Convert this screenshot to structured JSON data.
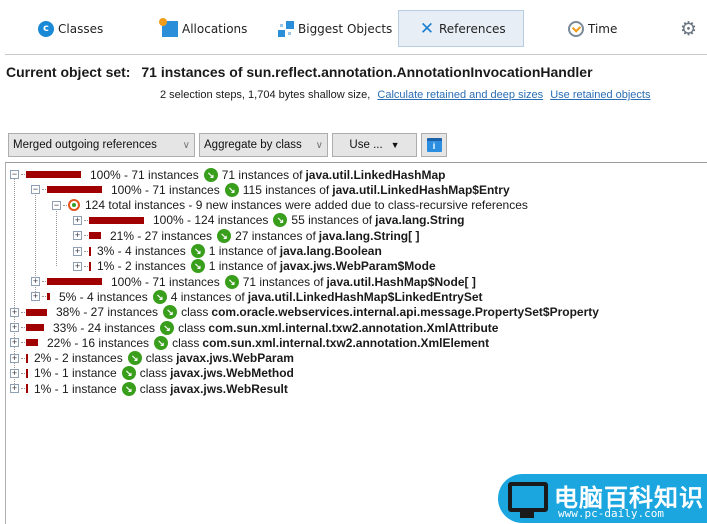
{
  "toolbar": {
    "tabs": [
      {
        "label": "Classes",
        "icon": "classes-icon",
        "active": false
      },
      {
        "label": "Allocations",
        "icon": "allocations-icon",
        "active": false
      },
      {
        "label": "Biggest Objects",
        "icon": "biggest-objects-icon",
        "active": false
      },
      {
        "label": "References",
        "icon": "references-icon",
        "active": true
      },
      {
        "label": "Time",
        "icon": "time-icon",
        "active": false
      },
      {
        "label": "",
        "icon": "gear-icon",
        "active": false
      }
    ]
  },
  "header": {
    "label": "Current object set:",
    "value": "71 instances of sun.reflect.annotation.AnnotationInvocationHandler",
    "info": "2 selection steps, 1,704 bytes shallow size,",
    "link_calculate": "Calculate retained and deep sizes",
    "link_use_retained": "Use retained objects"
  },
  "controls": {
    "view_mode": "Merged outgoing references",
    "aggregation": "Aggregate by class",
    "use_button": "Use ...",
    "use_arrow": "▼",
    "chevron": "∨",
    "info_button_icon": "i"
  },
  "tree": {
    "rows": [
      {
        "level": 0,
        "expander": "−",
        "percent": 100,
        "pct_text": "100% - 71 instances",
        "prefix": "71 instances of",
        "cls": "java.util.LinkedHashMap"
      },
      {
        "level": 1,
        "expander": "−",
        "percent": 100,
        "pct_text": "100% - 71 instances",
        "prefix": "115 instances of",
        "cls": "java.util.LinkedHashMap$Entry"
      },
      {
        "level": 2,
        "expander": "−",
        "recursive": true,
        "text": "124 total instances - 9 new instances were added due to class-recursive references"
      },
      {
        "level": 3,
        "expander": "+",
        "percent": 100,
        "pct_text": "100% - 124 instances",
        "prefix": "55 instances of",
        "cls": "java.lang.String"
      },
      {
        "level": 3,
        "expander": "+",
        "percent": 21,
        "pct_text": "21% - 27 instances",
        "prefix": "27 instances of",
        "cls": "java.lang.String[ ]"
      },
      {
        "level": 3,
        "expander": "+",
        "percent": 3,
        "pct_text": "3% - 4 instances",
        "prefix": "1 instance of",
        "cls": "java.lang.Boolean"
      },
      {
        "level": 3,
        "expander": "+",
        "percent": 1,
        "pct_text": "1% - 2 instances",
        "prefix": "1 instance of",
        "cls": "javax.jws.WebParam$Mode"
      },
      {
        "level": 1,
        "expander": "+",
        "percent": 100,
        "pct_text": "100% - 71 instances",
        "prefix": "71 instances of",
        "cls": "java.util.HashMap$Node[ ]"
      },
      {
        "level": 1,
        "expander": "+",
        "percent": 5,
        "pct_text": "5% - 4 instances",
        "prefix": "4 instances of",
        "cls": "java.util.LinkedHashMap$LinkedEntrySet"
      },
      {
        "level": 0,
        "expander": "+",
        "percent": 38,
        "pct_text": "38% - 27 instances",
        "prefix": "class",
        "cls": "com.oracle.webservices.internal.api.message.PropertySet$Property"
      },
      {
        "level": 0,
        "expander": "+",
        "percent": 33,
        "pct_text": "33% - 24 instances",
        "prefix": "class",
        "cls": "com.sun.xml.internal.txw2.annotation.XmlAttribute"
      },
      {
        "level": 0,
        "expander": "+",
        "percent": 22,
        "pct_text": "22% - 16 instances",
        "prefix": "class",
        "cls": "com.sun.xml.internal.txw2.annotation.XmlElement"
      },
      {
        "level": 0,
        "expander": "+",
        "percent": 2,
        "pct_text": "2% - 2 instances",
        "prefix": "class",
        "cls": "javax.jws.WebParam"
      },
      {
        "level": 0,
        "expander": "+",
        "percent": 1,
        "pct_text": "1% - 1 instance",
        "prefix": "class",
        "cls": "javax.jws.WebMethod"
      },
      {
        "level": 0,
        "expander": "+",
        "percent": 1,
        "pct_text": "1% - 1 instance",
        "prefix": "class",
        "cls": "javax.jws.WebResult"
      }
    ]
  },
  "watermark": {
    "title": "电脑百科知识",
    "url": "www.pc-daily.com"
  },
  "colors": {
    "bar": "#a00000",
    "reference_icon": "#3a9e1d",
    "link": "#2a6db5",
    "active_tab_bg": "#e7eef6",
    "watermark_bg": "#1ba6e0"
  }
}
